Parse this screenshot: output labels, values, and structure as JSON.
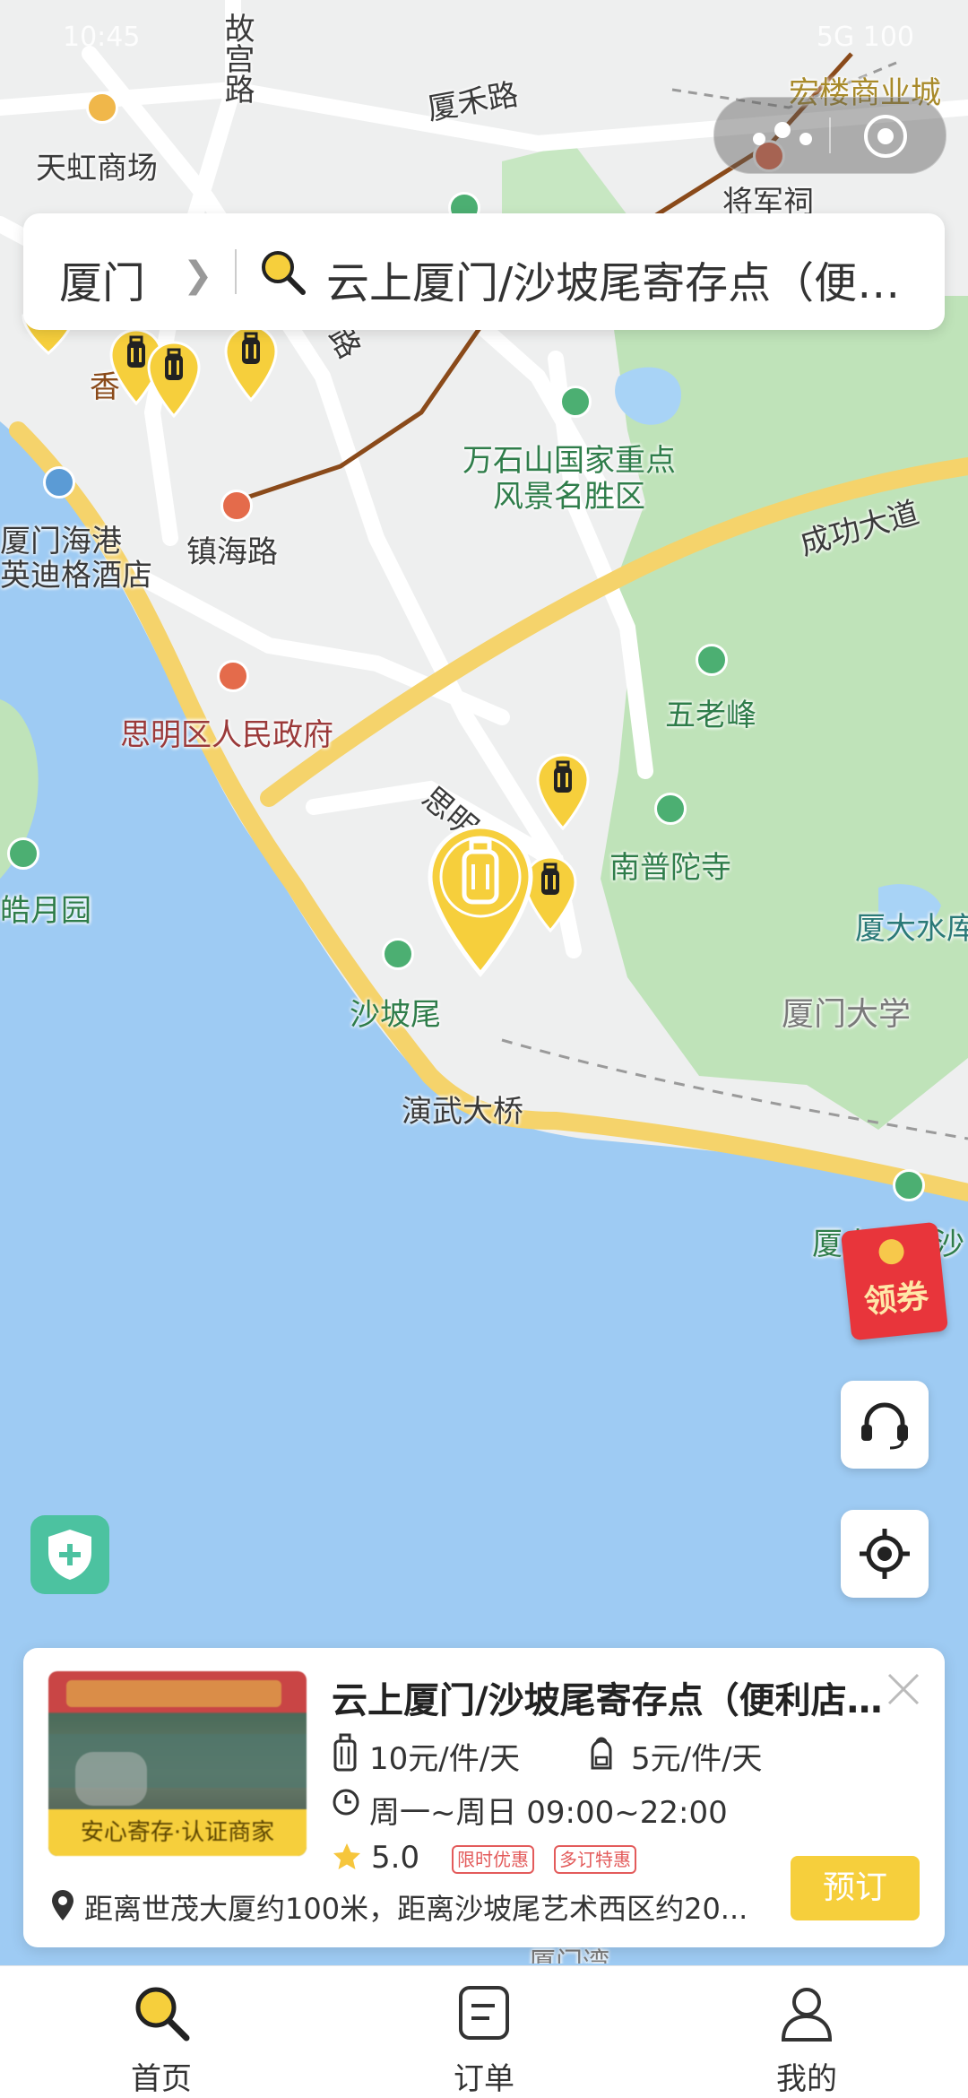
{
  "status_bar": {
    "time": "10:45",
    "right": "5G 100"
  },
  "search": {
    "city": "厦门",
    "query": "云上厦门/沙坡尾寄存点（便利..."
  },
  "map": {
    "labels": {
      "gugonglu": "故宫路",
      "xiahelu": "厦禾路",
      "tianhong": "天虹商场",
      "honglou": "宏楼商业城",
      "jiangjunci": "将军祠",
      "xiangshidai": "香",
      "wanshishan": "万石山国家重点",
      "wanshishan2": "风景名胜区",
      "chenggong": "成功大道",
      "harbor_hotel_1": "厦门海港",
      "harbor_hotel_2": "英迪格酒店",
      "zhenhailu": "镇海路",
      "wulaofeng": "五老峰",
      "siming_gov": "思明区人民政府",
      "siming_road": "思明",
      "nanputuo": "南普陀寺",
      "xiada_reservoir": "厦大水库",
      "shapowei": "沙坡尾",
      "xiada": "厦门大学",
      "yanwu": "演武大桥",
      "xiada_beach": "厦大白城沙",
      "haoyueyuan": "皓月园",
      "xiamenwan": "厦门湾",
      "lu": "路"
    }
  },
  "coupon": {
    "label": "领券"
  },
  "store_card": {
    "badge": "安心寄存·认证商家",
    "title": "云上厦门/沙坡尾寄存点（便利店...",
    "price_large": "10元/件/天",
    "price_small": "5元/件/天",
    "hours": "周一~周日 09:00~22:00",
    "rating": "5.0",
    "tag1": "限时优惠",
    "tag2": "多订特惠",
    "address": "距离世茂大厦约100米，距离沙坡尾艺术西区约20...",
    "book_label": "预订"
  },
  "tabbar": {
    "home": "首页",
    "orders": "订单",
    "mine": "我的"
  },
  "colors": {
    "accent": "#F6CF3C",
    "sea": "#9ECBF3",
    "park": "#B9E2B4"
  }
}
